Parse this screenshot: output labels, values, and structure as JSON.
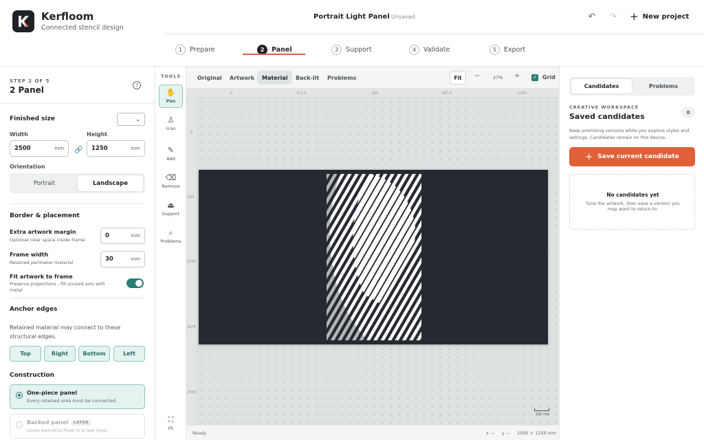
{
  "header": {
    "brand_name": "Kerfloom",
    "brand_sub": "Connected stencil design",
    "doc_title": "Portrait Light Panel",
    "doc_status": "Unsaved",
    "new_project_label": "New project"
  },
  "steps": [
    {
      "num": "1",
      "label": "Prepare"
    },
    {
      "num": "2",
      "label": "Panel"
    },
    {
      "num": "3",
      "label": "Support"
    },
    {
      "num": "4",
      "label": "Validate"
    },
    {
      "num": "5",
      "label": "Export"
    }
  ],
  "left_panel": {
    "step_of": "STEP 2 OF 5",
    "title": "2 Panel",
    "finished_size_label": "Finished size",
    "size_select_value": "",
    "width_label": "Width",
    "width_value": "2500",
    "height_label": "Height",
    "height_value": "1250",
    "unit": "mm",
    "orientation_label": "Orientation",
    "orientation_options": [
      "Portrait",
      "Landscape"
    ],
    "orientation_selected": "Landscape",
    "border_label": "Border & placement",
    "margin_title": "Extra artwork margin",
    "margin_desc": "Optional clear space inside frame",
    "margin_value": "0",
    "frame_title": "Frame width",
    "frame_desc": "Retained perimeter material",
    "frame_value": "30",
    "fit_title": "Fit artwork to frame",
    "fit_desc": "Preserve proportions - fill unused axis with metal",
    "fit_on": true,
    "anchor_label": "Anchor edges",
    "anchor_text": "Retained material may connect to these structural edges.",
    "edges": [
      "Top",
      "Right",
      "Bottom",
      "Left"
    ],
    "construction_label": "Construction",
    "one_piece_title": "One-piece panel",
    "one_piece_desc": "Every retained area must be connected.",
    "backed_title": "Backed panel",
    "backed_badge": "LATER",
    "backed_desc": "Loose elements fixed to a rear layer."
  },
  "tools": {
    "label": "TOOLS",
    "items": [
      "Pan",
      "Icon",
      "Add",
      "Remove",
      "Support",
      "Problems"
    ],
    "fit_label": "Fit"
  },
  "canvas": {
    "view_tabs": [
      "Original",
      "Artwork",
      "Material",
      "Back-lit",
      "Problems"
    ],
    "active_view": "Material",
    "fit_label": "Fit",
    "zoom_minus": "−",
    "zoom_value": "27%",
    "zoom_plus": "+",
    "grid_label": "Grid",
    "grid_on": true,
    "ruler_x": [
      "0",
      "312.5",
      "625",
      "937.5",
      "1250"
    ],
    "ruler_y": [
      "0",
      "625",
      "1250",
      "1875",
      "2500"
    ],
    "scale_label": "100 mm",
    "status_left": "Ready",
    "status_x": "x —",
    "status_y": "y —",
    "status_size": "2500 × 1250 mm"
  },
  "right_panel": {
    "tabs": [
      "Candidates",
      "Problems"
    ],
    "workspace_label": "CREATIVE WORKSPACE",
    "title": "Saved candidates",
    "count": "0",
    "desc": "Keep promising versions while you explore styles and settings. Candidates remain on this device.",
    "save_label": "Save current candidate",
    "empty_title": "No candidates yet",
    "empty_desc": "Tune the artwork, then save a version you may want to return to."
  },
  "colors": {
    "accent": "#e0603a",
    "teal": "#2a7d75",
    "panel_dark": "#262a30"
  }
}
